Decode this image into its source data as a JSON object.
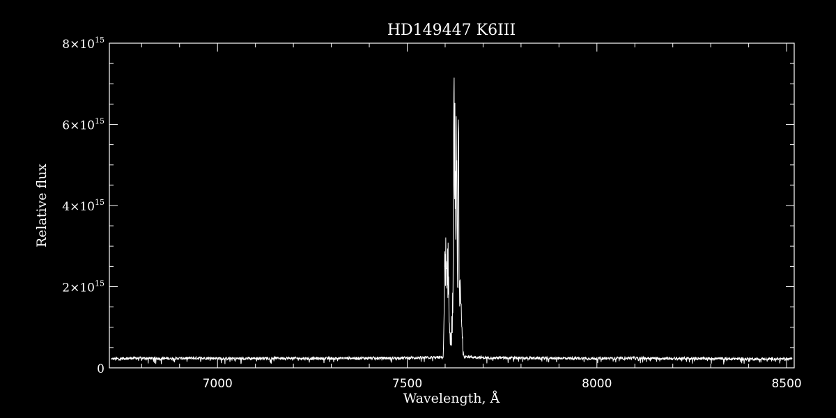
{
  "chart_data": {
    "type": "line",
    "title": "HD149447   K6III",
    "xlabel": "Wavelength, Å",
    "ylabel": "Relative flux",
    "xlim": [
      6715,
      8520
    ],
    "ylim": [
      0,
      8000000000000000.0
    ],
    "grid": false,
    "colors": {
      "background": "#000000",
      "foreground": "#ffffff"
    },
    "x_ticks": [
      {
        "value": 7000,
        "label": "7000"
      },
      {
        "value": 7500,
        "label": "7500"
      },
      {
        "value": 8000,
        "label": "8000"
      },
      {
        "value": 8500,
        "label": "8500"
      }
    ],
    "y_ticks": [
      {
        "value": 0,
        "mantissa": "0",
        "exponent": ""
      },
      {
        "value": 2000000000000000.0,
        "mantissa": "2×10",
        "exponent": "15"
      },
      {
        "value": 4000000000000000.0,
        "mantissa": "4×10",
        "exponent": "15"
      },
      {
        "value": 6000000000000000.0,
        "mantissa": "6×10",
        "exponent": "15"
      },
      {
        "value": 8000000000000000.0,
        "mantissa": "8×10",
        "exponent": "15"
      }
    ],
    "series": [
      {
        "continuum_level": 230000000000000.0,
        "x": [
          6720,
          6780,
          6850,
          6950,
          7050,
          7150,
          7250,
          7350,
          7450,
          7550,
          7595,
          7600,
          7604,
          7608,
          7612,
          7616,
          7620,
          7624,
          7628,
          7630,
          7632,
          7635,
          7638,
          7641,
          7645,
          7650,
          7700,
          7800,
          7900,
          8000,
          8100,
          8200,
          8300,
          8400,
          8500,
          8515
        ],
        "y": [
          220000000000000.0,
          240000000000000.0,
          230000000000000.0,
          240000000000000.0,
          230000000000000.0,
          240000000000000.0,
          230000000000000.0,
          240000000000000.0,
          240000000000000.0,
          250000000000000.0,
          260000000000000.0,
          2600000000000000.0,
          1800000000000000.0,
          2500000000000000.0,
          800000000000000.0,
          500000000000000.0,
          1500000000000000.0,
          6900000000000000.0,
          3600000000000000.0,
          5500000000000000.0,
          2000000000000000.0,
          4800000000000000.0,
          1200000000000000.0,
          1800000000000000.0,
          600000000000000.0,
          280000000000000.0,
          250000000000000.0,
          240000000000000.0,
          240000000000000.0,
          230000000000000.0,
          240000000000000.0,
          230000000000000.0,
          230000000000000.0,
          220000000000000.0,
          220000000000000.0,
          230000000000000.0
        ]
      }
    ]
  }
}
